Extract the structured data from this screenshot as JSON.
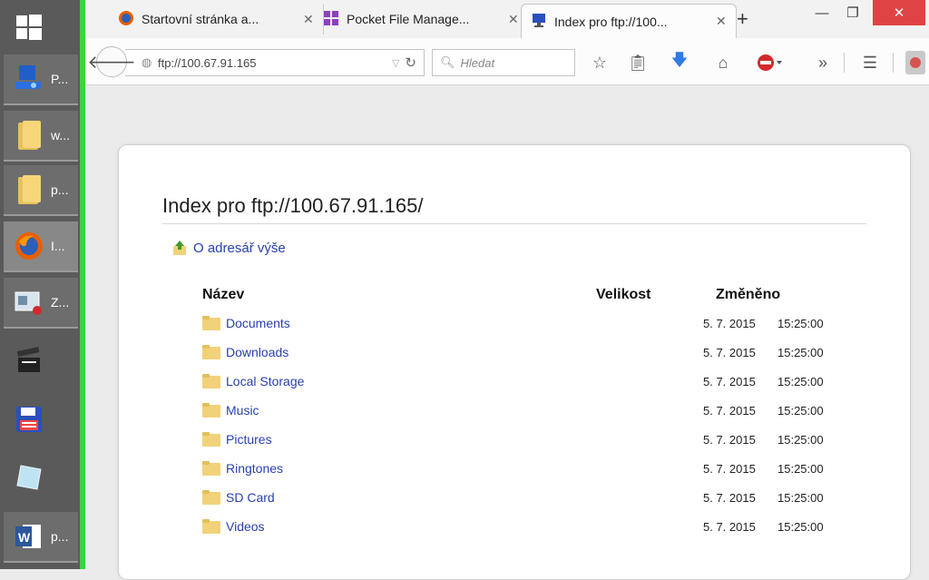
{
  "taskbar": {
    "items": [
      {
        "icon": "windows-start-icon",
        "label": ""
      },
      {
        "icon": "computer-icon",
        "label": "P..."
      },
      {
        "icon": "folder-icon",
        "label": "w..."
      },
      {
        "icon": "folder-icon",
        "label": "p..."
      },
      {
        "icon": "firefox-icon",
        "label": "I..."
      },
      {
        "icon": "presentation-icon",
        "label": "Z..."
      },
      {
        "icon": "clapperboard-icon",
        "label": ""
      },
      {
        "icon": "floppy-disk-icon",
        "label": ""
      },
      {
        "icon": "glass-pane-icon",
        "label": ""
      },
      {
        "icon": "word-icon",
        "label": "p..."
      }
    ]
  },
  "tabs": [
    {
      "title": "Startovní stránka a...",
      "icon": "firefox-icon"
    },
    {
      "title": "Pocket File Manage...",
      "icon": "windows-app-icon"
    },
    {
      "title": "Index pro ftp://100...",
      "icon": "monitor-icon"
    }
  ],
  "toolbar": {
    "url": "ftp://100.67.91.165",
    "search_placeholder": "Hledat"
  },
  "page": {
    "heading": "Index pro ftp://100.67.91.165/",
    "parent_link": "O adresář výše",
    "columns": {
      "name": "Název",
      "size": "Velikost",
      "modified": "Změněno"
    },
    "entries": [
      {
        "name": "Documents",
        "date": "5. 7. 2015",
        "time": "15:25:00"
      },
      {
        "name": "Downloads",
        "date": "5. 7. 2015",
        "time": "15:25:00"
      },
      {
        "name": "Local Storage",
        "date": "5. 7. 2015",
        "time": "15:25:00"
      },
      {
        "name": "Music",
        "date": "5. 7. 2015",
        "time": "15:25:00"
      },
      {
        "name": "Pictures",
        "date": "5. 7. 2015",
        "time": "15:25:00"
      },
      {
        "name": "Ringtones",
        "date": "5. 7. 2015",
        "time": "15:25:00"
      },
      {
        "name": "SD Card",
        "date": "5. 7. 2015",
        "time": "15:25:00"
      },
      {
        "name": "Videos",
        "date": "5. 7. 2015",
        "time": "15:25:00"
      }
    ]
  },
  "colors": {
    "accent_green": "#3ed23e",
    "link_blue": "#2a3fb0",
    "close_red": "#e04343"
  }
}
